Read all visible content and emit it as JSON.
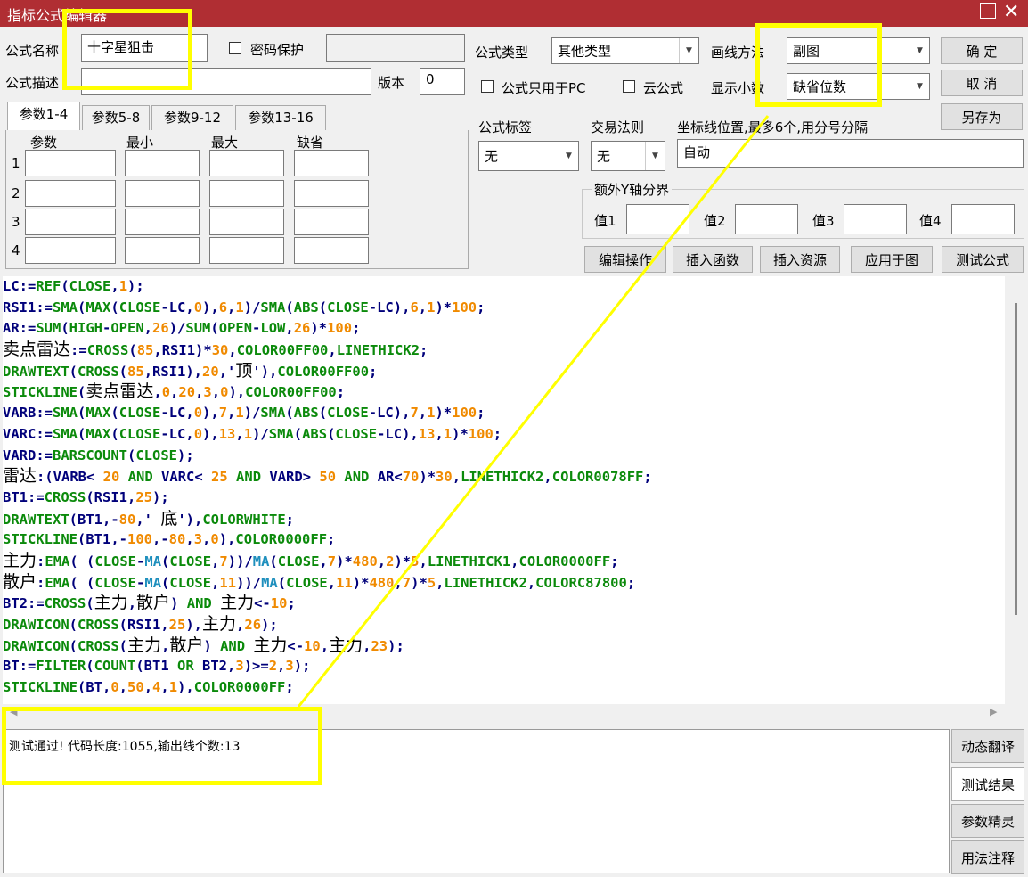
{
  "window": {
    "title": "指标公式编辑器",
    "max_icon": "maximize-icon",
    "close_icon": "close-icon"
  },
  "form": {
    "name_label": "公式名称",
    "name_value": "十字星狙击",
    "password_label": "密码保护",
    "password_value": "",
    "desc_label": "公式描述",
    "desc_value": "",
    "version_label": "版本",
    "version_value": "0",
    "type_label": "公式类型",
    "type_value": "其他类型",
    "draw_label": "画线方法",
    "draw_value": "副图",
    "pc_only_label": "公式只用于PC",
    "cloud_label": "云公式",
    "decimal_label": "显示小数",
    "decimal_value": "缺省位数",
    "tag_label": "公式标签",
    "tag_value": "无",
    "rule_label": "交易法则",
    "rule_value": "无",
    "axis_label": "坐标线位置,最多6个,用分号分隔",
    "axis_value": "自动",
    "yaxis_group": "额外Y轴分界",
    "y_labels": [
      "值1",
      "值2",
      "值3",
      "值4"
    ]
  },
  "buttons": {
    "ok": "确  定",
    "cancel": "取  消",
    "save_as": "另存为",
    "edit_ops": "编辑操作",
    "insert_func": "插入函数",
    "insert_res": "插入资源",
    "apply_chart": "应用于图",
    "test": "测试公式",
    "dyn_translate": "动态翻译",
    "test_result": "测试结果",
    "param_wizard": "参数精灵",
    "usage_note": "用法注释"
  },
  "params": {
    "tabs": [
      "参数1-4",
      "参数5-8",
      "参数9-12",
      "参数13-16"
    ],
    "headers": [
      "参数",
      "最小",
      "最大",
      "缺省"
    ],
    "rows": [
      "1",
      "2",
      "3",
      "4"
    ]
  },
  "code_lines": [
    [
      [
        "k",
        "LC:="
      ],
      [
        "f",
        "REF"
      ],
      [
        "k",
        "("
      ],
      [
        "f",
        "CLOSE"
      ],
      [
        "k",
        ","
      ],
      [
        "n",
        "1"
      ],
      [
        "k",
        ");"
      ]
    ],
    [
      [
        "k",
        "RSI1:="
      ],
      [
        "f",
        "SMA"
      ],
      [
        "k",
        "("
      ],
      [
        "f",
        "MAX"
      ],
      [
        "k",
        "("
      ],
      [
        "f",
        "CLOSE"
      ],
      [
        "k",
        "-LC,"
      ],
      [
        "n",
        "0"
      ],
      [
        "k",
        "),"
      ],
      [
        "n",
        "6"
      ],
      [
        "k",
        ","
      ],
      [
        "n",
        "1"
      ],
      [
        "k",
        ")/"
      ],
      [
        "f",
        "SMA"
      ],
      [
        "k",
        "("
      ],
      [
        "f",
        "ABS"
      ],
      [
        "k",
        "("
      ],
      [
        "f",
        "CLOSE"
      ],
      [
        "k",
        "-LC),"
      ],
      [
        "n",
        "6"
      ],
      [
        "k",
        ","
      ],
      [
        "n",
        "1"
      ],
      [
        "k",
        ")*"
      ],
      [
        "n",
        "100"
      ],
      [
        "k",
        ";"
      ]
    ],
    [
      [
        "k",
        "AR:="
      ],
      [
        "f",
        "SUM"
      ],
      [
        "k",
        "("
      ],
      [
        "f",
        "HIGH"
      ],
      [
        "k",
        "-"
      ],
      [
        "f",
        "OPEN"
      ],
      [
        "k",
        ","
      ],
      [
        "n",
        "26"
      ],
      [
        "k",
        ")/"
      ],
      [
        "f",
        "SUM"
      ],
      [
        "k",
        "("
      ],
      [
        "f",
        "OPEN"
      ],
      [
        "k",
        "-"
      ],
      [
        "f",
        "LOW"
      ],
      [
        "k",
        ","
      ],
      [
        "n",
        "26"
      ],
      [
        "k",
        ")*"
      ],
      [
        "n",
        "100"
      ],
      [
        "k",
        ";"
      ]
    ],
    [
      [
        "cn",
        "卖点雷达"
      ],
      [
        "k",
        ":="
      ],
      [
        "f",
        "CROSS"
      ],
      [
        "k",
        "("
      ],
      [
        "n",
        "85"
      ],
      [
        "k",
        ",RSI1)*"
      ],
      [
        "n",
        "30"
      ],
      [
        "k",
        ","
      ],
      [
        "f",
        "COLOR00FF00"
      ],
      [
        "k",
        ","
      ],
      [
        "f",
        "LINETHICK2"
      ],
      [
        "k",
        ";"
      ]
    ],
    [
      [
        "f",
        "DRAWTEXT"
      ],
      [
        "k",
        "("
      ],
      [
        "f",
        "CROSS"
      ],
      [
        "k",
        "("
      ],
      [
        "n",
        "85"
      ],
      [
        "k",
        ",RSI1),"
      ],
      [
        "n",
        "20"
      ],
      [
        "k",
        ",'"
      ],
      [
        "cn",
        "顶"
      ],
      [
        "k",
        "'),"
      ],
      [
        "f",
        "COLOR00FF00"
      ],
      [
        "k",
        ";"
      ]
    ],
    [
      [
        "f",
        "STICKLINE"
      ],
      [
        "k",
        "("
      ],
      [
        "cn",
        "卖点雷达"
      ],
      [
        "k",
        ","
      ],
      [
        "n",
        "0"
      ],
      [
        "k",
        ","
      ],
      [
        "n",
        "20"
      ],
      [
        "k",
        ","
      ],
      [
        "n",
        "3"
      ],
      [
        "k",
        ","
      ],
      [
        "n",
        "0"
      ],
      [
        "k",
        "),"
      ],
      [
        "f",
        "COLOR00FF00"
      ],
      [
        "k",
        ";"
      ]
    ],
    [
      [
        "k",
        "VARB:="
      ],
      [
        "f",
        "SMA"
      ],
      [
        "k",
        "("
      ],
      [
        "f",
        "MAX"
      ],
      [
        "k",
        "("
      ],
      [
        "f",
        "CLOSE"
      ],
      [
        "k",
        "-LC,"
      ],
      [
        "n",
        "0"
      ],
      [
        "k",
        "),"
      ],
      [
        "n",
        "7"
      ],
      [
        "k",
        ","
      ],
      [
        "n",
        "1"
      ],
      [
        "k",
        ")/"
      ],
      [
        "f",
        "SMA"
      ],
      [
        "k",
        "("
      ],
      [
        "f",
        "ABS"
      ],
      [
        "k",
        "("
      ],
      [
        "f",
        "CLOSE"
      ],
      [
        "k",
        "-LC),"
      ],
      [
        "n",
        "7"
      ],
      [
        "k",
        ","
      ],
      [
        "n",
        "1"
      ],
      [
        "k",
        ")*"
      ],
      [
        "n",
        "100"
      ],
      [
        "k",
        ";"
      ]
    ],
    [
      [
        "k",
        "VARC:="
      ],
      [
        "f",
        "SMA"
      ],
      [
        "k",
        "("
      ],
      [
        "f",
        "MAX"
      ],
      [
        "k",
        "("
      ],
      [
        "f",
        "CLOSE"
      ],
      [
        "k",
        "-LC,"
      ],
      [
        "n",
        "0"
      ],
      [
        "k",
        "),"
      ],
      [
        "n",
        "13"
      ],
      [
        "k",
        ","
      ],
      [
        "n",
        "1"
      ],
      [
        "k",
        ")/"
      ],
      [
        "f",
        "SMA"
      ],
      [
        "k",
        "("
      ],
      [
        "f",
        "ABS"
      ],
      [
        "k",
        "("
      ],
      [
        "f",
        "CLOSE"
      ],
      [
        "k",
        "-LC),"
      ],
      [
        "n",
        "13"
      ],
      [
        "k",
        ","
      ],
      [
        "n",
        "1"
      ],
      [
        "k",
        ")*"
      ],
      [
        "n",
        "100"
      ],
      [
        "k",
        ";"
      ]
    ],
    [
      [
        "k",
        "VARD:="
      ],
      [
        "f",
        "BARSCOUNT"
      ],
      [
        "k",
        "("
      ],
      [
        "f",
        "CLOSE"
      ],
      [
        "k",
        ");"
      ]
    ],
    [
      [
        "cn",
        "雷达"
      ],
      [
        "k",
        ":(VARB< "
      ],
      [
        "n",
        "20"
      ],
      [
        "k",
        " "
      ],
      [
        "f",
        "AND"
      ],
      [
        "k",
        " VARC< "
      ],
      [
        "n",
        "25"
      ],
      [
        "k",
        " "
      ],
      [
        "f",
        "AND"
      ],
      [
        "k",
        " VARD> "
      ],
      [
        "n",
        "50"
      ],
      [
        "k",
        " "
      ],
      [
        "f",
        "AND"
      ],
      [
        "k",
        " AR<"
      ],
      [
        "n",
        "70"
      ],
      [
        "k",
        ")*"
      ],
      [
        "n",
        "30"
      ],
      [
        "k",
        ","
      ],
      [
        "f",
        "LINETHICK2"
      ],
      [
        "k",
        ","
      ],
      [
        "f",
        "COLOR0078FF"
      ],
      [
        "k",
        ";"
      ]
    ],
    [
      [
        "k",
        "BT1:="
      ],
      [
        "f",
        "CROSS"
      ],
      [
        "k",
        "(RSI1,"
      ],
      [
        "n",
        "25"
      ],
      [
        "k",
        ");"
      ]
    ],
    [
      [
        "f",
        "DRAWTEXT"
      ],
      [
        "k",
        "(BT1,-"
      ],
      [
        "n",
        "80"
      ],
      [
        "k",
        ",' "
      ],
      [
        "cn",
        "底"
      ],
      [
        "k",
        "'),"
      ],
      [
        "f",
        "COLORWHITE"
      ],
      [
        "k",
        ";"
      ]
    ],
    [
      [
        "f",
        "STICKLINE"
      ],
      [
        "k",
        "(BT1,-"
      ],
      [
        "n",
        "100"
      ],
      [
        "k",
        ",-"
      ],
      [
        "n",
        "80"
      ],
      [
        "k",
        ","
      ],
      [
        "n",
        "3"
      ],
      [
        "k",
        ","
      ],
      [
        "n",
        "0"
      ],
      [
        "k",
        "),"
      ],
      [
        "f",
        "COLOR0000FF"
      ],
      [
        "k",
        ";"
      ]
    ],
    [
      [
        "cn",
        "主力"
      ],
      [
        "k",
        ":"
      ],
      [
        "f",
        "EMA"
      ],
      [
        "k",
        "( ("
      ],
      [
        "f",
        "CLOSE"
      ],
      [
        "k",
        "-"
      ],
      [
        "b",
        "MA"
      ],
      [
        "k",
        "("
      ],
      [
        "f",
        "CLOSE"
      ],
      [
        "k",
        ","
      ],
      [
        "n",
        "7"
      ],
      [
        "k",
        "))/"
      ],
      [
        "b",
        "MA"
      ],
      [
        "k",
        "("
      ],
      [
        "f",
        "CLOSE"
      ],
      [
        "k",
        ","
      ],
      [
        "n",
        "7"
      ],
      [
        "k",
        ")*"
      ],
      [
        "n",
        "480"
      ],
      [
        "k",
        ","
      ],
      [
        "n",
        "2"
      ],
      [
        "k",
        ")*"
      ],
      [
        "n",
        "5"
      ],
      [
        "k",
        ","
      ],
      [
        "f",
        "LINETHICK1"
      ],
      [
        "k",
        ","
      ],
      [
        "f",
        "COLOR0000FF"
      ],
      [
        "k",
        ";"
      ]
    ],
    [
      [
        "cn",
        "散户"
      ],
      [
        "k",
        ":"
      ],
      [
        "f",
        "EMA"
      ],
      [
        "k",
        "( ("
      ],
      [
        "f",
        "CLOSE"
      ],
      [
        "k",
        "-"
      ],
      [
        "b",
        "MA"
      ],
      [
        "k",
        "("
      ],
      [
        "f",
        "CLOSE"
      ],
      [
        "k",
        ","
      ],
      [
        "n",
        "11"
      ],
      [
        "k",
        "))/"
      ],
      [
        "b",
        "MA"
      ],
      [
        "k",
        "("
      ],
      [
        "f",
        "CLOSE"
      ],
      [
        "k",
        ","
      ],
      [
        "n",
        "11"
      ],
      [
        "k",
        ")*"
      ],
      [
        "n",
        "480"
      ],
      [
        "k",
        ","
      ],
      [
        "n",
        "7"
      ],
      [
        "k",
        ")*"
      ],
      [
        "n",
        "5"
      ],
      [
        "k",
        ","
      ],
      [
        "f",
        "LINETHICK2"
      ],
      [
        "k",
        ","
      ],
      [
        "f",
        "COLORC87800"
      ],
      [
        "k",
        ";"
      ]
    ],
    [
      [
        "k",
        "BT2:="
      ],
      [
        "f",
        "CROSS"
      ],
      [
        "k",
        "("
      ],
      [
        "cn",
        "主力"
      ],
      [
        "k",
        ","
      ],
      [
        "cn",
        "散户"
      ],
      [
        "k",
        ") "
      ],
      [
        "f",
        "AND"
      ],
      [
        "k",
        " "
      ],
      [
        "cn",
        "主力"
      ],
      [
        "k",
        "<-"
      ],
      [
        "n",
        "10"
      ],
      [
        "k",
        ";"
      ]
    ],
    [
      [
        "f",
        "DRAWICON"
      ],
      [
        "k",
        "("
      ],
      [
        "f",
        "CROSS"
      ],
      [
        "k",
        "(RSI1,"
      ],
      [
        "n",
        "25"
      ],
      [
        "k",
        "),"
      ],
      [
        "cn",
        "主力"
      ],
      [
        "k",
        ","
      ],
      [
        "n",
        "26"
      ],
      [
        "k",
        ");"
      ]
    ],
    [
      [
        "f",
        "DRAWICON"
      ],
      [
        "k",
        "("
      ],
      [
        "f",
        "CROSS"
      ],
      [
        "k",
        "("
      ],
      [
        "cn",
        "主力"
      ],
      [
        "k",
        ","
      ],
      [
        "cn",
        "散户"
      ],
      [
        "k",
        ") "
      ],
      [
        "f",
        "AND"
      ],
      [
        "k",
        " "
      ],
      [
        "cn",
        "主力"
      ],
      [
        "k",
        "<-"
      ],
      [
        "n",
        "10"
      ],
      [
        "k",
        ","
      ],
      [
        "cn",
        "主力"
      ],
      [
        "k",
        ","
      ],
      [
        "n",
        "23"
      ],
      [
        "k",
        ");"
      ]
    ],
    [
      [
        "k",
        "BT:="
      ],
      [
        "f",
        "FILTER"
      ],
      [
        "k",
        "("
      ],
      [
        "f",
        "COUNT"
      ],
      [
        "k",
        "(BT1 "
      ],
      [
        "f",
        "OR"
      ],
      [
        "k",
        " BT2,"
      ],
      [
        "n",
        "3"
      ],
      [
        "k",
        ")>="
      ],
      [
        "n",
        "2"
      ],
      [
        "k",
        ","
      ],
      [
        "n",
        "3"
      ],
      [
        "k",
        ");"
      ]
    ],
    [
      [
        "f",
        "STICKLINE"
      ],
      [
        "k",
        "(BT,"
      ],
      [
        "n",
        "0"
      ],
      [
        "k",
        ","
      ],
      [
        "n",
        "50"
      ],
      [
        "k",
        ","
      ],
      [
        "n",
        "4"
      ],
      [
        "k",
        ","
      ],
      [
        "n",
        "1"
      ],
      [
        "k",
        "),"
      ],
      [
        "f",
        "COLOR0000FF"
      ],
      [
        "k",
        ";"
      ]
    ]
  ],
  "output_text": "测试通过! 代码长度:1055,输出线个数:13"
}
